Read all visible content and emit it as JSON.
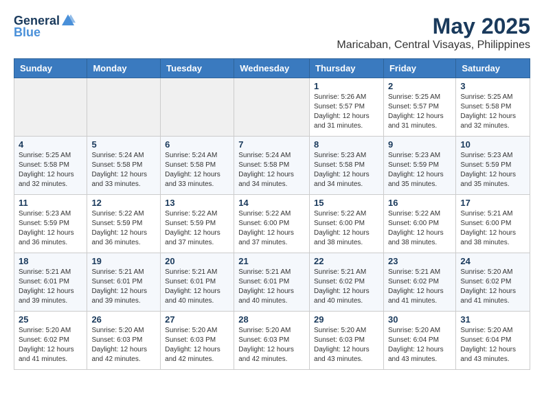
{
  "logo": {
    "general": "General",
    "blue": "Blue"
  },
  "title": "May 2025",
  "subtitle": "Maricaban, Central Visayas, Philippines",
  "headers": [
    "Sunday",
    "Monday",
    "Tuesday",
    "Wednesday",
    "Thursday",
    "Friday",
    "Saturday"
  ],
  "weeks": [
    [
      {
        "day": "",
        "info": ""
      },
      {
        "day": "",
        "info": ""
      },
      {
        "day": "",
        "info": ""
      },
      {
        "day": "",
        "info": ""
      },
      {
        "day": "1",
        "info": "Sunrise: 5:26 AM\nSunset: 5:57 PM\nDaylight: 12 hours and 31 minutes."
      },
      {
        "day": "2",
        "info": "Sunrise: 5:25 AM\nSunset: 5:57 PM\nDaylight: 12 hours and 31 minutes."
      },
      {
        "day": "3",
        "info": "Sunrise: 5:25 AM\nSunset: 5:58 PM\nDaylight: 12 hours and 32 minutes."
      }
    ],
    [
      {
        "day": "4",
        "info": "Sunrise: 5:25 AM\nSunset: 5:58 PM\nDaylight: 12 hours and 32 minutes."
      },
      {
        "day": "5",
        "info": "Sunrise: 5:24 AM\nSunset: 5:58 PM\nDaylight: 12 hours and 33 minutes."
      },
      {
        "day": "6",
        "info": "Sunrise: 5:24 AM\nSunset: 5:58 PM\nDaylight: 12 hours and 33 minutes."
      },
      {
        "day": "7",
        "info": "Sunrise: 5:24 AM\nSunset: 5:58 PM\nDaylight: 12 hours and 34 minutes."
      },
      {
        "day": "8",
        "info": "Sunrise: 5:23 AM\nSunset: 5:58 PM\nDaylight: 12 hours and 34 minutes."
      },
      {
        "day": "9",
        "info": "Sunrise: 5:23 AM\nSunset: 5:59 PM\nDaylight: 12 hours and 35 minutes."
      },
      {
        "day": "10",
        "info": "Sunrise: 5:23 AM\nSunset: 5:59 PM\nDaylight: 12 hours and 35 minutes."
      }
    ],
    [
      {
        "day": "11",
        "info": "Sunrise: 5:23 AM\nSunset: 5:59 PM\nDaylight: 12 hours and 36 minutes."
      },
      {
        "day": "12",
        "info": "Sunrise: 5:22 AM\nSunset: 5:59 PM\nDaylight: 12 hours and 36 minutes."
      },
      {
        "day": "13",
        "info": "Sunrise: 5:22 AM\nSunset: 5:59 PM\nDaylight: 12 hours and 37 minutes."
      },
      {
        "day": "14",
        "info": "Sunrise: 5:22 AM\nSunset: 6:00 PM\nDaylight: 12 hours and 37 minutes."
      },
      {
        "day": "15",
        "info": "Sunrise: 5:22 AM\nSunset: 6:00 PM\nDaylight: 12 hours and 38 minutes."
      },
      {
        "day": "16",
        "info": "Sunrise: 5:22 AM\nSunset: 6:00 PM\nDaylight: 12 hours and 38 minutes."
      },
      {
        "day": "17",
        "info": "Sunrise: 5:21 AM\nSunset: 6:00 PM\nDaylight: 12 hours and 38 minutes."
      }
    ],
    [
      {
        "day": "18",
        "info": "Sunrise: 5:21 AM\nSunset: 6:01 PM\nDaylight: 12 hours and 39 minutes."
      },
      {
        "day": "19",
        "info": "Sunrise: 5:21 AM\nSunset: 6:01 PM\nDaylight: 12 hours and 39 minutes."
      },
      {
        "day": "20",
        "info": "Sunrise: 5:21 AM\nSunset: 6:01 PM\nDaylight: 12 hours and 40 minutes."
      },
      {
        "day": "21",
        "info": "Sunrise: 5:21 AM\nSunset: 6:01 PM\nDaylight: 12 hours and 40 minutes."
      },
      {
        "day": "22",
        "info": "Sunrise: 5:21 AM\nSunset: 6:02 PM\nDaylight: 12 hours and 40 minutes."
      },
      {
        "day": "23",
        "info": "Sunrise: 5:21 AM\nSunset: 6:02 PM\nDaylight: 12 hours and 41 minutes."
      },
      {
        "day": "24",
        "info": "Sunrise: 5:20 AM\nSunset: 6:02 PM\nDaylight: 12 hours and 41 minutes."
      }
    ],
    [
      {
        "day": "25",
        "info": "Sunrise: 5:20 AM\nSunset: 6:02 PM\nDaylight: 12 hours and 41 minutes."
      },
      {
        "day": "26",
        "info": "Sunrise: 5:20 AM\nSunset: 6:03 PM\nDaylight: 12 hours and 42 minutes."
      },
      {
        "day": "27",
        "info": "Sunrise: 5:20 AM\nSunset: 6:03 PM\nDaylight: 12 hours and 42 minutes."
      },
      {
        "day": "28",
        "info": "Sunrise: 5:20 AM\nSunset: 6:03 PM\nDaylight: 12 hours and 42 minutes."
      },
      {
        "day": "29",
        "info": "Sunrise: 5:20 AM\nSunset: 6:03 PM\nDaylight: 12 hours and 43 minutes."
      },
      {
        "day": "30",
        "info": "Sunrise: 5:20 AM\nSunset: 6:04 PM\nDaylight: 12 hours and 43 minutes."
      },
      {
        "day": "31",
        "info": "Sunrise: 5:20 AM\nSunset: 6:04 PM\nDaylight: 12 hours and 43 minutes."
      }
    ]
  ]
}
